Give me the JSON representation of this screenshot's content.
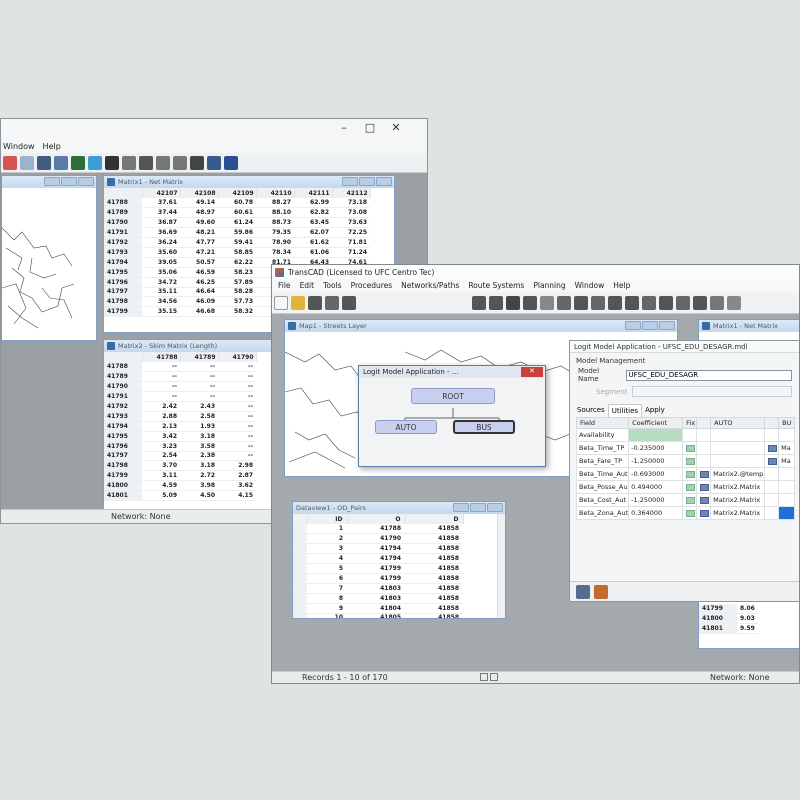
{
  "back_window": {
    "menu": [
      "Window",
      "Help"
    ],
    "matrix1_title": "Matrix1 - Net Matrix",
    "matrix1_cols": [
      "42107",
      "42108",
      "42109",
      "42110",
      "42111",
      "42112"
    ],
    "matrix1_rows": [
      [
        "41788",
        "37.61",
        "49.14",
        "60.78",
        "88.27",
        "62.99",
        "73.18"
      ],
      [
        "41789",
        "37.44",
        "48.97",
        "60.61",
        "88.10",
        "62.82",
        "73.08"
      ],
      [
        "41790",
        "36.87",
        "49.60",
        "61.24",
        "88.73",
        "63.45",
        "73.63"
      ],
      [
        "41791",
        "36.69",
        "48.21",
        "59.86",
        "79.35",
        "62.07",
        "72.25"
      ],
      [
        "41792",
        "36.24",
        "47.77",
        "59.41",
        "78.90",
        "61.62",
        "71.81"
      ],
      [
        "41793",
        "35.60",
        "47.21",
        "58.85",
        "78.34",
        "61.06",
        "71.24"
      ],
      [
        "41794",
        "39.05",
        "50.57",
        "62.22",
        "81.71",
        "64.43",
        "74.61"
      ],
      [
        "41795",
        "35.06",
        "46.59",
        "58.23",
        "77.72",
        "60.44",
        "70.62"
      ],
      [
        "41796",
        "34.72",
        "46.25",
        "57.89",
        "77.38",
        "60.10",
        "70.28"
      ],
      [
        "41797",
        "35.11",
        "46.64",
        "58.28",
        "77.77",
        "60.49",
        "70.67"
      ],
      [
        "41798",
        "34.56",
        "46.09",
        "57.73",
        "77.22",
        "59.94",
        "70.12"
      ],
      [
        "41799",
        "35.15",
        "46.68",
        "58.32",
        "77.81",
        "60.53",
        "70.71"
      ]
    ],
    "matrix2_title": "Matrix2 - Skim Matrix (Length)",
    "matrix2_cols": [
      "41788",
      "41789",
      "41790"
    ],
    "matrix2_rows": [
      [
        "41788",
        "--",
        "--",
        "--"
      ],
      [
        "41789",
        "--",
        "--",
        "--"
      ],
      [
        "41790",
        "--",
        "--",
        "--"
      ],
      [
        "41791",
        "--",
        "--",
        "--"
      ],
      [
        "41792",
        "2.42",
        "2.43",
        "--"
      ],
      [
        "41793",
        "2.88",
        "2.58",
        "--"
      ],
      [
        "41794",
        "2.13",
        "1.93",
        "--"
      ],
      [
        "41795",
        "3.42",
        "3.18",
        "--"
      ],
      [
        "41796",
        "3.23",
        "3.58",
        "--"
      ],
      [
        "41797",
        "2.54",
        "2.38",
        "--"
      ],
      [
        "41798",
        "3.70",
        "3.18",
        "2.98"
      ],
      [
        "41799",
        "3.11",
        "2.72",
        "2.87"
      ],
      [
        "41800",
        "4.59",
        "3.98",
        "3.62"
      ],
      [
        "41801",
        "5.09",
        "4.50",
        "4.15"
      ]
    ],
    "status": "Network: None"
  },
  "front_window": {
    "title": "TransCAD (Licensed to UFC Centro Tec)",
    "menu": [
      "File",
      "Edit",
      "Tools",
      "Procedures",
      "Networks/Paths",
      "Route Systems",
      "Planning",
      "Window",
      "Help"
    ],
    "map_title": "Map1 - Streets Layer",
    "logit_dialog": {
      "title": "Logit Model Application - ...",
      "root": "ROOT",
      "auto": "AUTO",
      "bus": "BUS"
    },
    "panel": {
      "title": "Logit Model Application - UFSC_EDU_DESAGR.mdl",
      "section": "Model Management",
      "model_name_label": "Model Name",
      "model_name_value": "UFSC_EDU_DESAGR",
      "segment_label": "Segment",
      "tabs": [
        "Sources",
        "Utilities",
        "Apply"
      ],
      "columns": [
        "Field",
        "Coefficient",
        "Fix",
        "",
        "AUTO",
        "",
        "BU"
      ],
      "rows": [
        {
          "field": "Availability",
          "coef": "",
          "fix": "",
          "auto": "",
          "bus": ""
        },
        {
          "field": "Beta_Time_TP",
          "coef": "-0.235000",
          "fix": "",
          "auto": "",
          "bus": "Ma"
        },
        {
          "field": "Beta_Fare_TP",
          "coef": "-1.250000",
          "fix": "",
          "auto": "",
          "bus": "Ma"
        },
        {
          "field": "Beta_Time_Aut",
          "coef": "-0.693000",
          "fix": "",
          "auto": "Matrix2.@temp",
          "bus": ""
        },
        {
          "field": "Beta_Posse_Au",
          "coef": "0.494000",
          "fix": "",
          "auto": "Matrix2.Matrix",
          "bus": ""
        },
        {
          "field": "Beta_Cost_Aut",
          "coef": "-1.250000",
          "fix": "",
          "auto": "Matrix2.Matrix",
          "bus": ""
        },
        {
          "field": "Beta_Zona_Aut",
          "coef": "0.364000",
          "fix": "",
          "auto": "Matrix2.Matrix",
          "bus": ""
        }
      ]
    },
    "dataview": {
      "title": "Dataview1 - OD_Pairs",
      "cols": [
        "ID",
        "O",
        "D"
      ],
      "rows": [
        [
          "1",
          "41788",
          "41858"
        ],
        [
          "2",
          "41790",
          "41858"
        ],
        [
          "3",
          "41794",
          "41858"
        ],
        [
          "4",
          "41794",
          "41858"
        ],
        [
          "5",
          "41799",
          "41858"
        ],
        [
          "6",
          "41799",
          "41858"
        ],
        [
          "7",
          "41803",
          "41858"
        ],
        [
          "8",
          "41803",
          "41858"
        ],
        [
          "9",
          "41804",
          "41858"
        ],
        [
          "10",
          "41805",
          "41858"
        ]
      ]
    },
    "matrix_behind_title": "Matrix1 - Net Matrix",
    "matrix_behind_rows": [
      [
        "41799",
        "8.06"
      ],
      [
        "41800",
        "9.03"
      ],
      [
        "41801",
        "9.59"
      ]
    ],
    "status_records": "Records 1 - 10 of 170",
    "status_network": "Network: None"
  }
}
